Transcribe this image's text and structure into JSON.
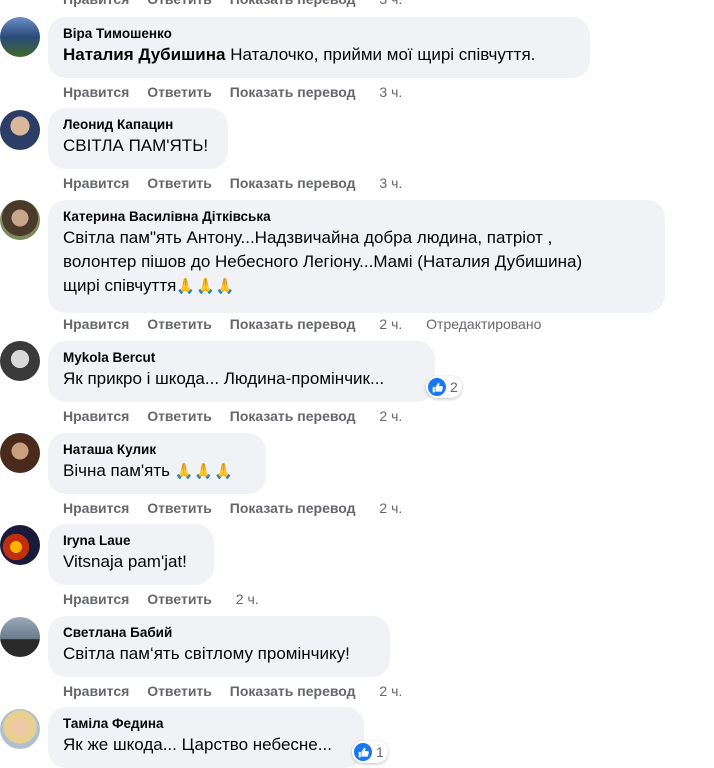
{
  "actions": {
    "like": "Нравится",
    "reply": "Ответить",
    "translate": "Показать перевод"
  },
  "comments": [
    {
      "author": "Віра Тимошенко",
      "mention": "Наталия Дубишина",
      "text": " Наталочко, прийми мої щирі співчуття.",
      "time": "3 ч."
    },
    {
      "author": "Леонид Капацин",
      "text": "СВІТЛА ПАМ'ЯТЬ!",
      "time": "3 ч."
    },
    {
      "author": "Катерина Василівна Дітківська",
      "text_lines": [
        "Світла пам\"ять Антону...Надзвичайна добра людина, патріот ,",
        "волонтер пішов до Небесного Легіону...Мамі (Наталия Дубишина)",
        "щирі співчуття"
      ],
      "emoji": "🙏🙏🙏",
      "time": "2 ч.",
      "edited": "Отредактировано"
    },
    {
      "author": "Mykola Bercut",
      "text": "Як прикро і шкода... Людина-промінчик...",
      "time": "2 ч.",
      "reactions": "2"
    },
    {
      "author": "Наташа Кулик",
      "text": "Вічна пам'ять ",
      "emoji": "🙏🙏🙏",
      "time": "2 ч."
    },
    {
      "author": "Iryna Laue",
      "text": "Vitsnaja pam'jat!",
      "time": "2 ч."
    },
    {
      "author": "Светлана Бабий",
      "text": "Світла пам‘ять світлому промінчику!",
      "time": "2 ч."
    },
    {
      "author": "Таміла Федина",
      "text": "Як же шкода... Царство небесне...",
      "reactions": "1"
    }
  ],
  "colors": {
    "bubble": "#f0f2f5",
    "secondary_text": "#65676b",
    "like_blue": "#1877f2"
  }
}
